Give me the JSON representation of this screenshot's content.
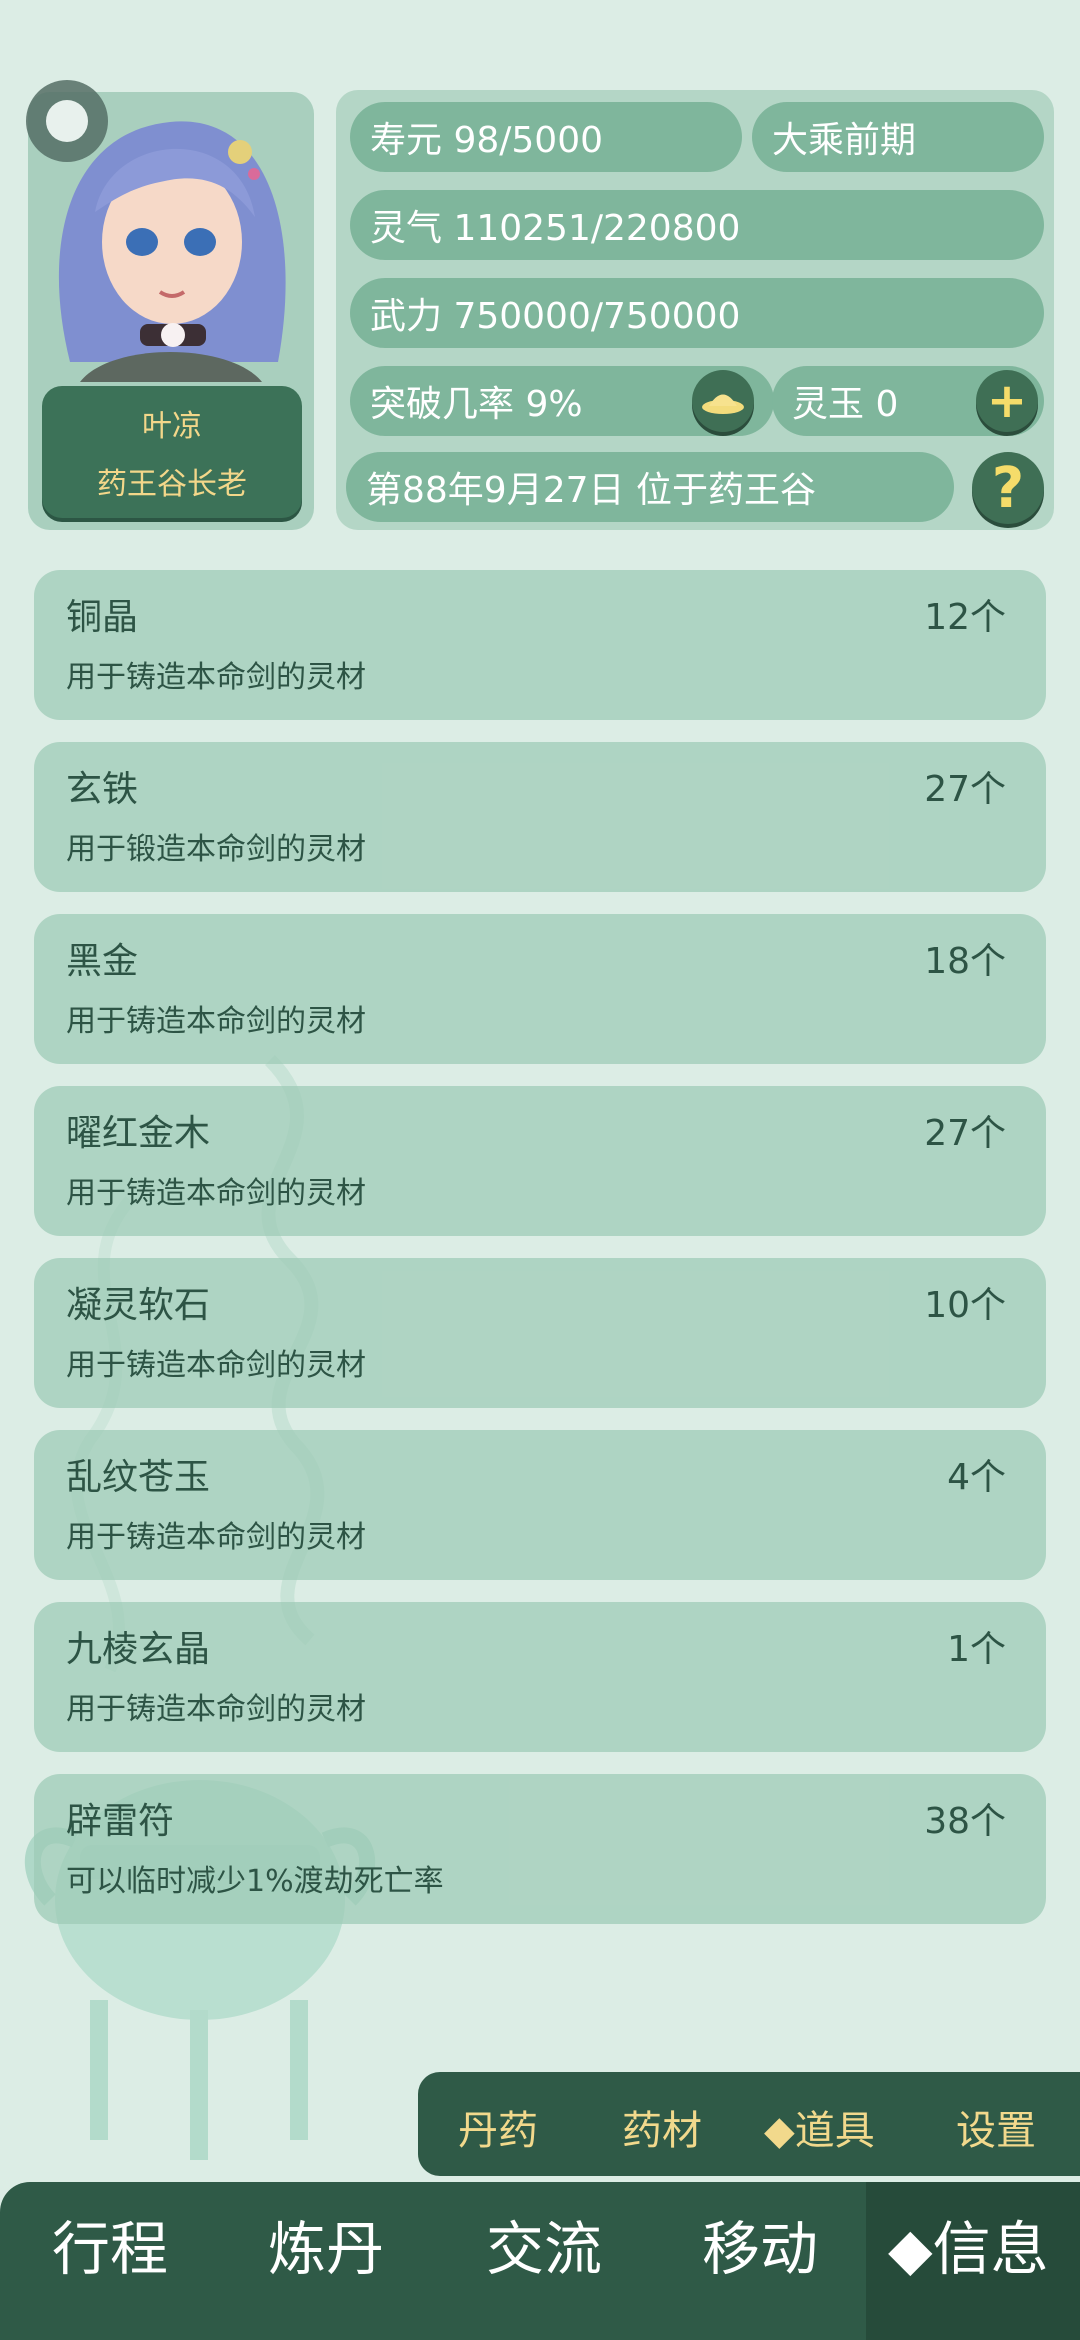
{
  "character": {
    "name": "叶凉",
    "title": "药王谷长老"
  },
  "stats": {
    "lifespan": "寿元 98/5000",
    "realm": "大乘前期",
    "spirit": "灵气 110251/220800",
    "force": "武力 750000/750000",
    "breakthrough": "突破几率 9%",
    "jade": "灵玉 0",
    "date_location": "第88年9月27日 位于药王谷"
  },
  "buttons": {
    "help": "?",
    "add": "+"
  },
  "items": [
    {
      "name": "铜晶",
      "count": "12个",
      "desc": "用于铸造本命剑的灵材"
    },
    {
      "name": "玄铁",
      "count": "27个",
      "desc": "用于锻造本命剑的灵材"
    },
    {
      "name": "黑金",
      "count": "18个",
      "desc": "用于铸造本命剑的灵材"
    },
    {
      "name": "曜红金木",
      "count": "27个",
      "desc": "用于铸造本命剑的灵材"
    },
    {
      "name": "凝灵软石",
      "count": "10个",
      "desc": "用于铸造本命剑的灵材"
    },
    {
      "name": "乱纹苍玉",
      "count": "4个",
      "desc": "用于铸造本命剑的灵材"
    },
    {
      "name": "九棱玄晶",
      "count": "1个",
      "desc": "用于铸造本命剑的灵材"
    },
    {
      "name": "辟雷符",
      "count": "38个",
      "desc": "可以临时减少1%渡劫死亡率"
    }
  ],
  "sub_tabs": [
    "丹药",
    "药材",
    "◆道具",
    "设置"
  ],
  "main_nav": [
    "行程",
    "炼丹",
    "交流",
    "移动",
    "◆信息"
  ],
  "colors": {
    "background": "#dcede5",
    "panel": "#b4d6c6",
    "pill": "#7fb69c",
    "nav": "#2f5a47",
    "gold_text": "#f2d98c",
    "help_icon": "#f5dc6a"
  },
  "icons": [
    "toggle-icon",
    "lotus-hat-icon",
    "plus-icon",
    "question-icon",
    "incense-vessel-background"
  ]
}
